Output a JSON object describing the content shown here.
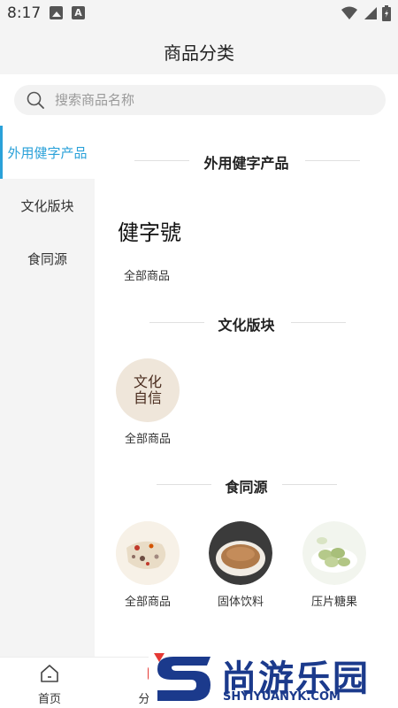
{
  "status_bar": {
    "time": "8:17"
  },
  "header": {
    "title": "商品分类"
  },
  "search": {
    "placeholder": "搜索商品名称"
  },
  "sidebar": {
    "items": [
      {
        "label": "外用健字产品",
        "active": true
      },
      {
        "label": "文化版块",
        "active": false
      },
      {
        "label": "食同源",
        "active": false
      }
    ]
  },
  "sections": [
    {
      "title": "外用健字产品",
      "brand": "健字號",
      "items": [
        {
          "label": "全部商品"
        }
      ]
    },
    {
      "title": "文化版块",
      "items": [
        {
          "label": "全部商品",
          "image_text": "文化自信"
        }
      ]
    },
    {
      "title": "食同源",
      "items": [
        {
          "label": "全部商品"
        },
        {
          "label": "固体饮料"
        },
        {
          "label": "压片糖果"
        }
      ]
    }
  ],
  "tabbar": {
    "tabs": [
      {
        "label": "首页"
      },
      {
        "label": "分"
      }
    ]
  },
  "watermark": {
    "cn": "尚游乐园",
    "en": "SHYIYUANYK.COM"
  },
  "colors": {
    "accent": "#2aa1d9",
    "brand_blue": "#1b3a8c",
    "brand_red": "#e53935"
  }
}
